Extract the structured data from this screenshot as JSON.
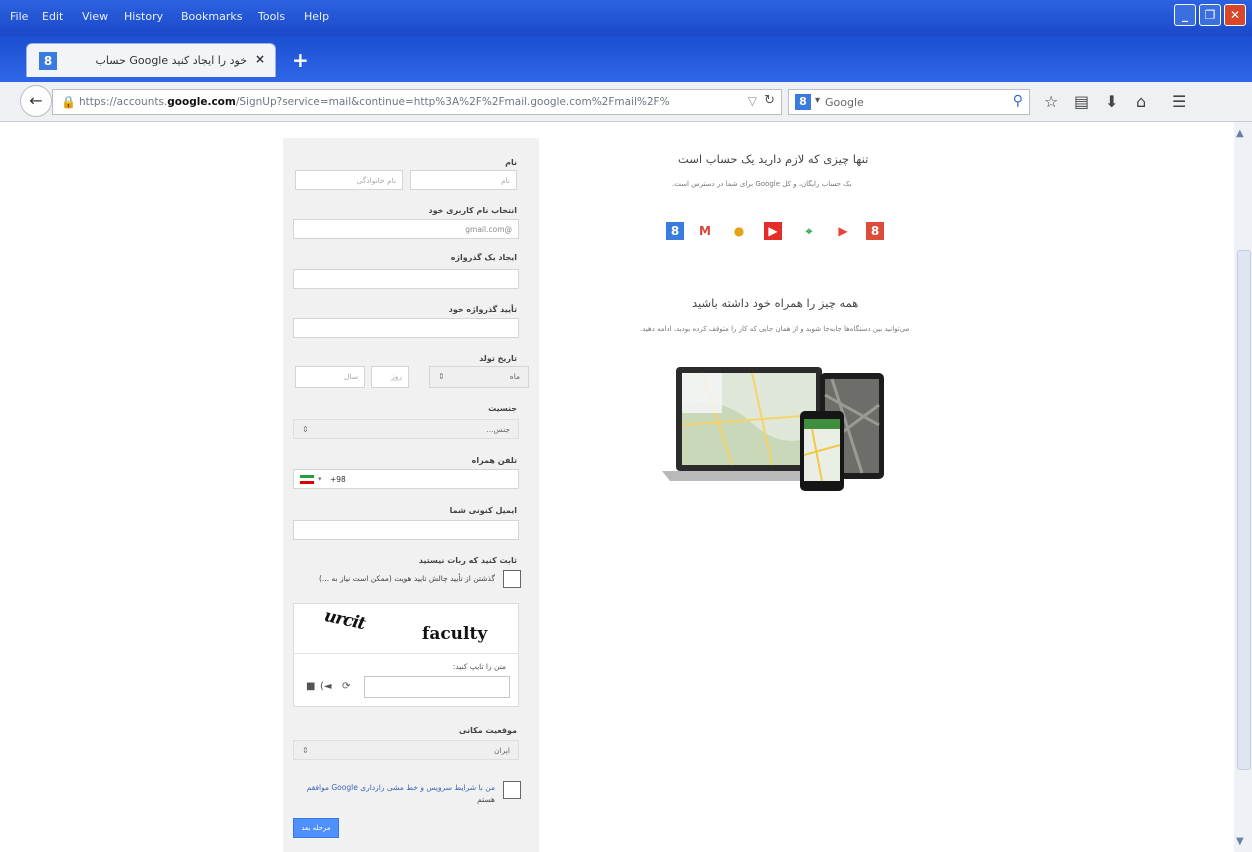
{
  "browser": {
    "menu": [
      "File",
      "Edit",
      "View",
      "History",
      "Bookmarks",
      "Tools",
      "Help"
    ],
    "tab_title": "خود را ایجاد کنید Google حساب",
    "tab_close": "×",
    "new_tab": "+",
    "url_prefix": "https://accounts.",
    "url_domain": "google.com",
    "url_suffix": "/SignUp?service=mail&continue=http%3A%2F%2Fmail.google.com%2Fmail%2F%",
    "search_placeholder": "Google",
    "window_buttons": [
      "_",
      "❐",
      "✕"
    ]
  },
  "form": {
    "name_label": "نام",
    "first_name_placeholder": "نام",
    "last_name_placeholder": "نام خانوادگی",
    "username_label": "انتخاب نام کاربری خود",
    "username_suffix": "@gmail.com",
    "password_label": "ایجاد یک گذرواژه",
    "confirm_label": "تأیید گذرواژه خود",
    "birthday_label": "تاریخ تولد",
    "month_value": "ماه",
    "day_placeholder": "روز",
    "year_placeholder": "سال",
    "gender_label": "جنسیت",
    "gender_value": "جنس...",
    "phone_label": "تلفن همراه",
    "phone_prefix": "+98",
    "email_label": "ایمیل کنونی شما",
    "skip_label": "ثابت کنید که ربات نیستید",
    "skip_text": "گذشتن از تأیید چالش تایید هویت (ممکن است نیاز به ...)",
    "captcha_word1": "urcit",
    "captcha_word2": "faculty",
    "captcha_prompt": "متن را تایپ کنید:",
    "location_label": "موقعیت مکانی",
    "location_value": "ایران",
    "terms_text": "من با شرایط سرویس و خط مشی رازداری Google موافقم",
    "terms_text2": "هستم",
    "submit_label": "مرحله بعد"
  },
  "promo": {
    "title1": "تنها چیزی که لازم دارید یک حساب است",
    "sub1": "یک حساب رایگان، و کل Google برای شما در دسترس است.",
    "title2": "همه چیز را همراه خود داشته باشید",
    "sub2": "می‌توانید بین دستگاه‌ها جابه‌جا شوید و از همان جایی که کار را متوقف کرده بودید، ادامه دهید.",
    "services": [
      {
        "name": "google-plus-icon",
        "glyph": "8",
        "color": "#3a7be0",
        "fg": "#ffffff"
      },
      {
        "name": "gmail-icon",
        "glyph": "M",
        "color": "#ffffff",
        "fg": "#d44638"
      },
      {
        "name": "chrome-icon",
        "glyph": "●",
        "color": "#ffffff",
        "fg": "#e7a21a"
      },
      {
        "name": "youtube-icon",
        "glyph": "▶",
        "color": "#e52d27",
        "fg": "#ffffff"
      },
      {
        "name": "maps-icon",
        "glyph": "⌖",
        "color": "#ffffff",
        "fg": "#34a853"
      },
      {
        "name": "play-icon",
        "glyph": "▶",
        "color": "#ffffff",
        "fg": "#ea4335"
      },
      {
        "name": "google-plus-red-icon",
        "glyph": "8",
        "color": "#dd4b39",
        "fg": "#ffffff"
      }
    ]
  }
}
